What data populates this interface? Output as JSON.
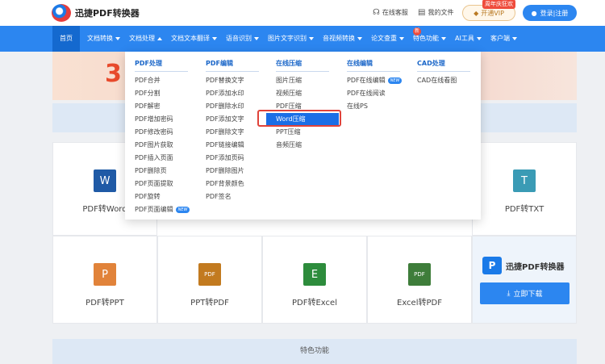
{
  "header": {
    "logo_text": "迅捷PDF转换器",
    "customer_service": "在线客服",
    "my_files": "我的文件",
    "vip_label": "开通VIP",
    "vip_badge": "周年庆狂欢",
    "login_label": "登录|注册"
  },
  "nav": {
    "items": [
      {
        "label": "首页"
      },
      {
        "label": "文档转换"
      },
      {
        "label": "文档处理"
      },
      {
        "label": "文档文本翻译"
      },
      {
        "label": "语音识别"
      },
      {
        "label": "图片文字识别"
      },
      {
        "label": "音视频转换"
      },
      {
        "label": "论文查重"
      },
      {
        "label": "特色功能"
      },
      {
        "label": "AI工具"
      },
      {
        "label": "客户端"
      }
    ],
    "new_badge": "新"
  },
  "dropdown": {
    "columns": [
      {
        "title": "PDF处理",
        "items": [
          "PDF合并",
          "PDF分割",
          "PDF解密",
          "PDF增加密码",
          "PDF修改密码",
          "PDF图片获取",
          "PDF插入页面",
          "PDF删除页",
          "PDF页面提取",
          "PDF旋转",
          "PDF页面编辑"
        ]
      },
      {
        "title": "PDF编辑",
        "items": [
          "PDF替换文字",
          "PDF添加水印",
          "PDF删除水印",
          "PDF添加文字",
          "PDF删除文字",
          "PDF链接编辑",
          "PDF添加页码",
          "PDF删除图片",
          "PDF背景颜色",
          "PDF签名"
        ]
      },
      {
        "title": "在线压缩",
        "items": [
          "图片压缩",
          "视频压缩",
          "PDF压缩",
          "Word压缩",
          "PPT压缩",
          "音频压缩"
        ]
      },
      {
        "title": "在线编辑",
        "items": [
          "PDF在线编辑",
          "PDF在线阅读",
          "在线PS"
        ]
      },
      {
        "title": "CAD处理",
        "items": [
          "CAD在线看图"
        ]
      }
    ],
    "new_tag": "NEW"
  },
  "tools": [
    {
      "label": "PDF转Word",
      "glyph": "W",
      "color": "#1f5aa6"
    },
    {
      "label": "PDF转TXT",
      "glyph": "T",
      "color": "#3a9bb5"
    },
    {
      "label": "PDF转PPT",
      "glyph": "P",
      "color": "#e1833a"
    },
    {
      "label": "PPT转PDF",
      "glyph": "PDF",
      "color": "#c27a1f"
    },
    {
      "label": "PDF转Excel",
      "glyph": "E",
      "color": "#2d8c3c"
    },
    {
      "label": "Excel转PDF",
      "glyph": "PDF",
      "color": "#3e7d3a"
    }
  ],
  "promo": {
    "logo_mark": "P",
    "logo_text": "迅捷PDF转换器",
    "download_label": "立即下载"
  },
  "feature_bar": "特色功能",
  "colors": {
    "primary": "#2c86f0",
    "highlight_border": "#e0433a"
  }
}
